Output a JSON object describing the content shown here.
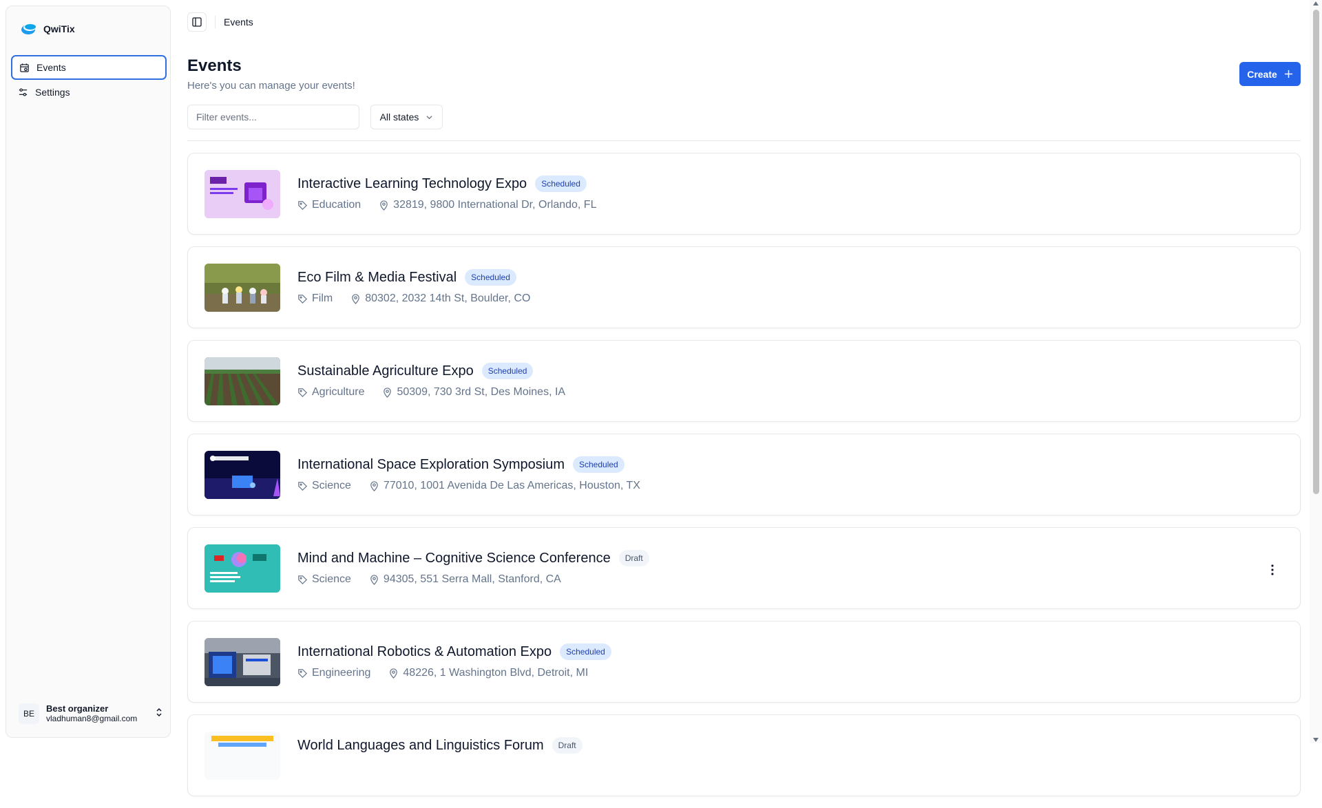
{
  "app": {
    "name": "QwiTix"
  },
  "sidebar": {
    "items": [
      {
        "label": "Events",
        "icon": "calendar-icon",
        "active": true
      },
      {
        "label": "Settings",
        "icon": "sliders-icon",
        "active": false
      }
    ],
    "user": {
      "initials": "BE",
      "name": "Best organizer",
      "email": "vladhuman8@gmail.com"
    }
  },
  "topbar": {
    "breadcrumb": "Events"
  },
  "header": {
    "title": "Events",
    "subtitle": "Here's you can manage your events!",
    "create_label": "Create"
  },
  "filters": {
    "search_placeholder": "Filter events...",
    "state_label": "All states"
  },
  "colors": {
    "accent": "#2563eb",
    "badge_scheduled_bg": "#dbeafe",
    "badge_draft_bg": "#f1f5f9"
  },
  "events": [
    {
      "name": "Interactive Learning Technology Expo",
      "status": "Scheduled",
      "category": "Education",
      "location": "32819, 9800 International Dr, Orlando, FL",
      "thumb": "purple-expo"
    },
    {
      "name": "Eco Film & Media Festival",
      "status": "Scheduled",
      "category": "Film",
      "location": "80302, 2032 14th St, Boulder, CO",
      "thumb": "outdoor-people"
    },
    {
      "name": "Sustainable Agriculture Expo",
      "status": "Scheduled",
      "category": "Agriculture",
      "location": "50309, 730 3rd St, Des Moines, IA",
      "thumb": "crop-field"
    },
    {
      "name": "International Space Exploration Symposium",
      "status": "Scheduled",
      "category": "Science",
      "location": "77010, 1001 Avenida De Las Americas, Houston, TX",
      "thumb": "space-stage"
    },
    {
      "name": "Mind and Machine – Cognitive Science Conference",
      "status": "Draft",
      "category": "Science",
      "location": "94305, 551 Serra Mall, Stanford, CA",
      "thumb": "teal-brain"
    },
    {
      "name": "International Robotics & Automation Expo",
      "status": "Scheduled",
      "category": "Engineering",
      "location": "48226, 1 Washington Blvd, Detroit, MI",
      "thumb": "expo-hall"
    },
    {
      "name": "World Languages and Linguistics Forum",
      "status": "Draft",
      "category": "",
      "location": "",
      "thumb": "language"
    }
  ]
}
